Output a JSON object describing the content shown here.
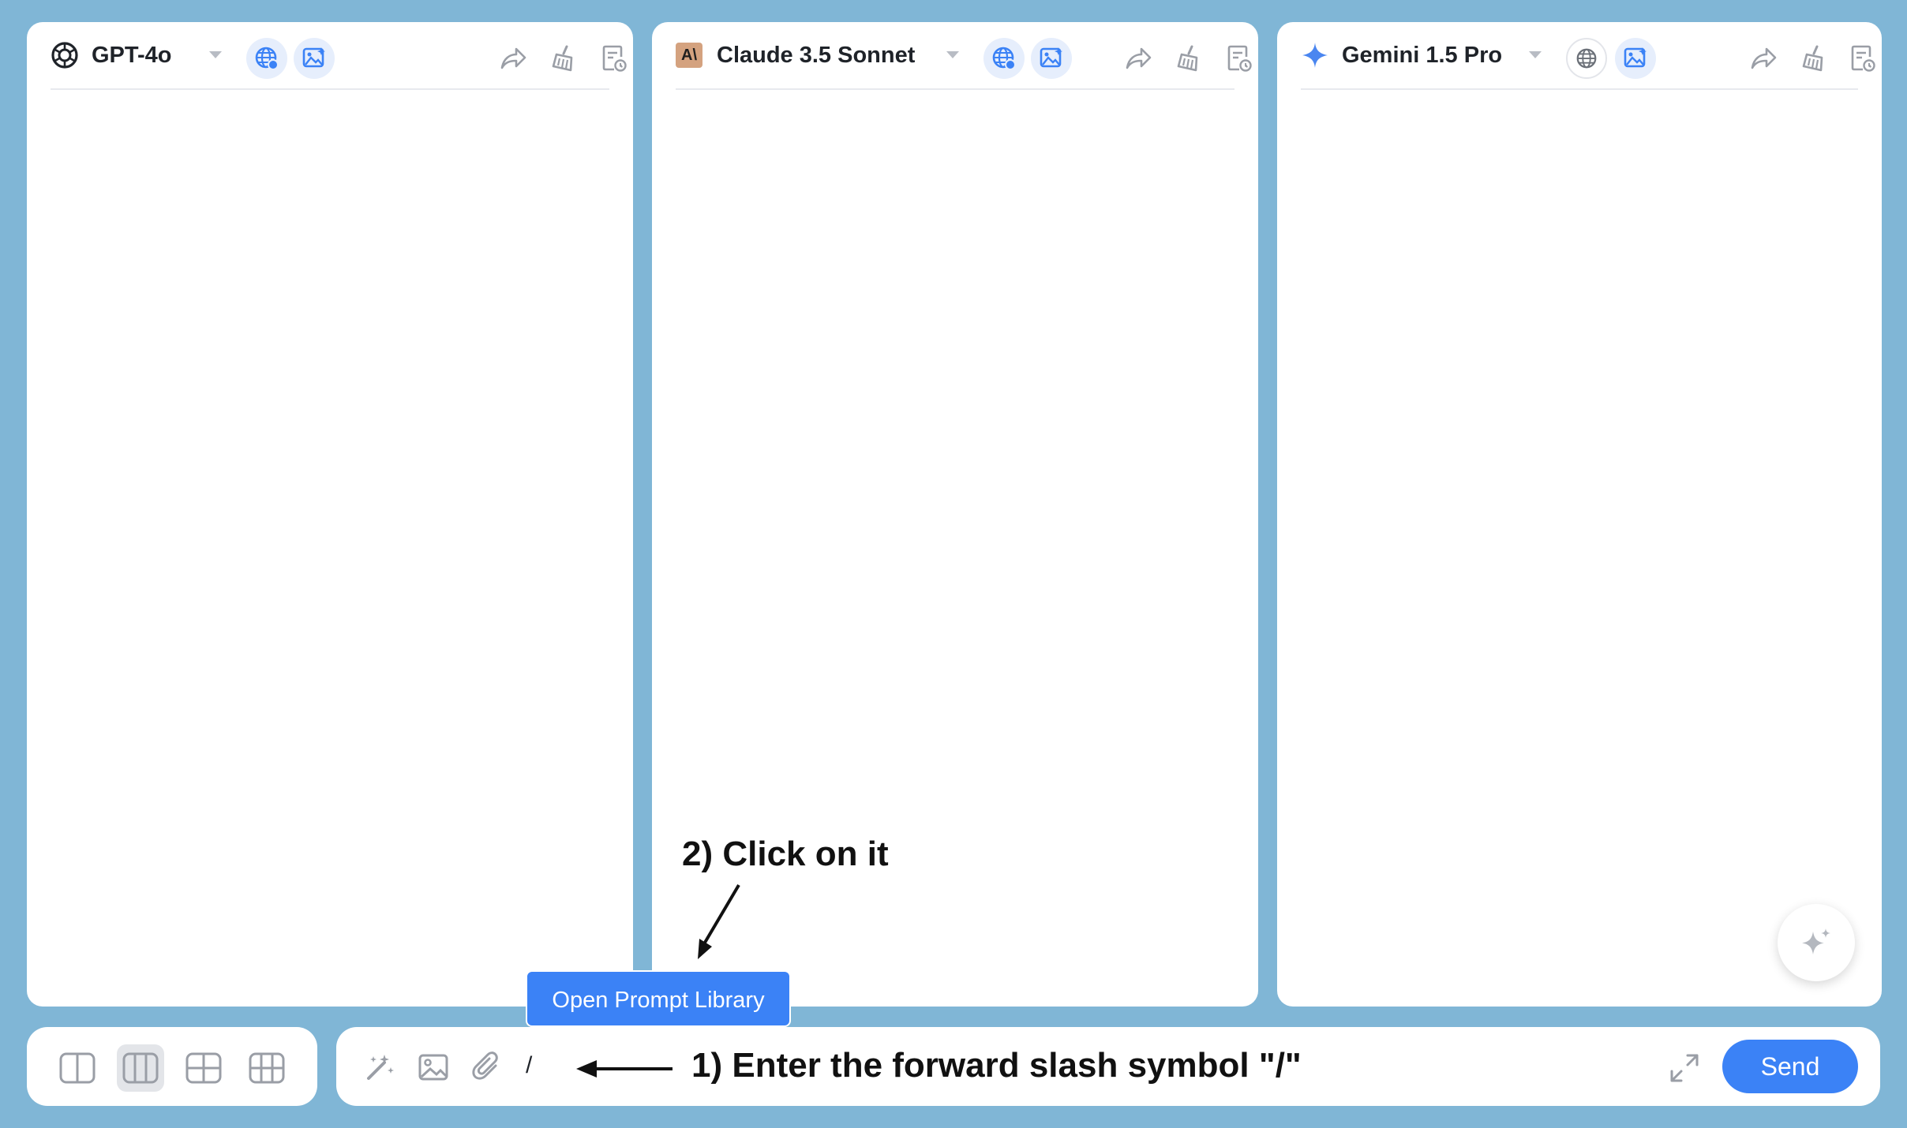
{
  "panels": [
    {
      "model_name": "GPT-4o",
      "logo_icon": "openai-logo-icon",
      "web_search_on": true,
      "image_gen_on": true
    },
    {
      "model_name": "Claude 3.5 Sonnet",
      "logo_icon": "anthropic-logo-icon",
      "logo_text": "A\\",
      "web_search_on": true,
      "image_gen_on": true
    },
    {
      "model_name": "Gemini 1.5 Pro",
      "logo_icon": "gemini-sparkle-icon",
      "web_search_on": false,
      "image_gen_on": true
    }
  ],
  "header_tools": [
    "share-icon",
    "clear-chat-icon",
    "history-icon"
  ],
  "layout_options": [
    "one-column",
    "three-columns",
    "two-by-two-grid",
    "three-by-two-grid"
  ],
  "layout_selected": "three-columns",
  "input": {
    "tools": [
      "magic-wand-icon",
      "image-icon",
      "paperclip-icon"
    ],
    "value": "/",
    "send_label": "Send"
  },
  "tooltip": {
    "label": "Open Prompt Library"
  },
  "annotations": {
    "step1": "1) Enter the forward slash symbol \"/\"",
    "step2": "2) Click on it"
  },
  "colors": {
    "background": "#80b6d6",
    "accent": "#3b82f6",
    "chip_active": "#e6eefc",
    "icon_gray": "#9a9ea6"
  }
}
